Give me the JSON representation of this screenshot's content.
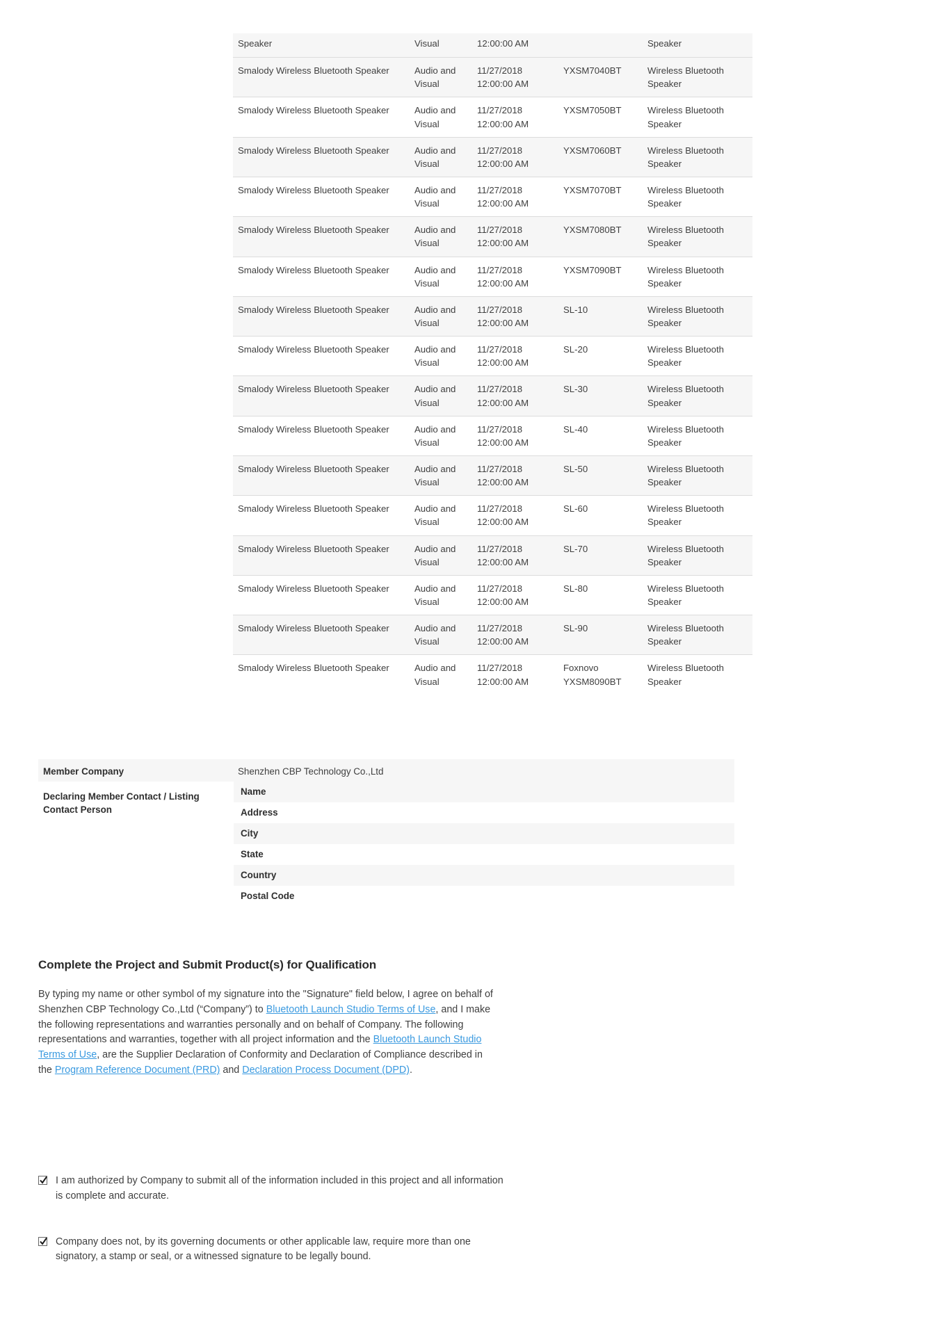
{
  "product_table": {
    "partial_first_row": {
      "name": "Speaker",
      "type": "Visual",
      "date": "12:00:00 AM",
      "model": "",
      "category": "Speaker"
    },
    "rows": [
      {
        "name": "Smalody Wireless Bluetooth Speaker",
        "type": "Audio and Visual",
        "date": "11/27/2018 12:00:00 AM",
        "model": "YXSM7040BT",
        "category": "Wireless Bluetooth Speaker"
      },
      {
        "name": "Smalody Wireless Bluetooth Speaker",
        "type": "Audio and Visual",
        "date": "11/27/2018 12:00:00 AM",
        "model": "YXSM7050BT",
        "category": "Wireless Bluetooth Speaker"
      },
      {
        "name": "Smalody Wireless Bluetooth Speaker",
        "type": "Audio and Visual",
        "date": "11/27/2018 12:00:00 AM",
        "model": "YXSM7060BT",
        "category": "Wireless Bluetooth Speaker"
      },
      {
        "name": "Smalody Wireless Bluetooth Speaker",
        "type": "Audio and Visual",
        "date": "11/27/2018 12:00:00 AM",
        "model": "YXSM7070BT",
        "category": "Wireless Bluetooth Speaker"
      },
      {
        "name": "Smalody Wireless Bluetooth Speaker",
        "type": "Audio and Visual",
        "date": "11/27/2018 12:00:00 AM",
        "model": "YXSM7080BT",
        "category": "Wireless Bluetooth Speaker"
      },
      {
        "name": "Smalody Wireless Bluetooth Speaker",
        "type": "Audio and Visual",
        "date": "11/27/2018 12:00:00 AM",
        "model": "YXSM7090BT",
        "category": "Wireless Bluetooth Speaker"
      },
      {
        "name": "Smalody Wireless Bluetooth Speaker",
        "type": "Audio and Visual",
        "date": "11/27/2018 12:00:00 AM",
        "model": "SL-10",
        "category": "Wireless Bluetooth Speaker"
      },
      {
        "name": "Smalody Wireless Bluetooth Speaker",
        "type": "Audio and Visual",
        "date": "11/27/2018 12:00:00 AM",
        "model": "SL-20",
        "category": "Wireless Bluetooth Speaker"
      },
      {
        "name": "Smalody Wireless Bluetooth Speaker",
        "type": "Audio and Visual",
        "date": "11/27/2018 12:00:00 AM",
        "model": "SL-30",
        "category": "Wireless Bluetooth Speaker"
      },
      {
        "name": "Smalody Wireless Bluetooth Speaker",
        "type": "Audio and Visual",
        "date": "11/27/2018 12:00:00 AM",
        "model": "SL-40",
        "category": "Wireless Bluetooth Speaker"
      },
      {
        "name": "Smalody Wireless Bluetooth Speaker",
        "type": "Audio and Visual",
        "date": "11/27/2018 12:00:00 AM",
        "model": "SL-50",
        "category": "Wireless Bluetooth Speaker"
      },
      {
        "name": "Smalody Wireless Bluetooth Speaker",
        "type": "Audio and Visual",
        "date": "11/27/2018 12:00:00 AM",
        "model": "SL-60",
        "category": "Wireless Bluetooth Speaker"
      },
      {
        "name": "Smalody Wireless Bluetooth Speaker",
        "type": "Audio and Visual",
        "date": "11/27/2018 12:00:00 AM",
        "model": "SL-70",
        "category": "Wireless Bluetooth Speaker"
      },
      {
        "name": "Smalody Wireless Bluetooth Speaker",
        "type": "Audio and Visual",
        "date": "11/27/2018 12:00:00 AM",
        "model": "SL-80",
        "category": "Wireless Bluetooth Speaker"
      },
      {
        "name": "Smalody Wireless Bluetooth Speaker",
        "type": "Audio and Visual",
        "date": "11/27/2018 12:00:00 AM",
        "model": "SL-90",
        "category": "Wireless Bluetooth Speaker"
      },
      {
        "name": "Smalody Wireless Bluetooth Speaker",
        "type": "Audio and Visual",
        "date": "11/27/2018 12:00:00 AM",
        "model": "Foxnovo YXSM8090BT",
        "category": "Wireless Bluetooth Speaker"
      }
    ]
  },
  "member_section": {
    "member_company_label": "Member Company",
    "member_company_value": "Shenzhen CBP Technology Co.,Ltd",
    "contact_label": "Declaring Member Contact / Listing Contact Person",
    "contact_fields": [
      "Name",
      "Address",
      "City",
      "State",
      "Country",
      "Postal Code"
    ]
  },
  "declaration": {
    "heading": "Complete the Project and Submit Product(s) for Qualification",
    "paragraph": {
      "p1": "By typing my name or other symbol of my signature into the \"Signature\" field below, I agree on behalf of Shenzhen CBP Technology Co.,Ltd (“Company”) to ",
      "link1": "Bluetooth Launch Studio Terms of Use",
      "p2": ", and I make the following representations and warranties personally and on behalf of Company. The following representations and warranties, together with all project information and the ",
      "link2": "Bluetooth Launch Studio Terms of Use",
      "p3": ", are the Supplier Declaration of Conformity and Declaration of Compliance described in the ",
      "link3": "Program Reference Document (PRD)",
      "p4": " and ",
      "link4": "Declaration Process Document (DPD)",
      "p5": "."
    },
    "checklist": [
      {
        "checked": true,
        "text": "I am authorized by Company to submit all of the information included in this project and all information is complete and accurate."
      },
      {
        "checked": true,
        "text": "Company does not, by its governing documents or other applicable law, require more than one signatory, a stamp or seal, or a witnessed signature to be legally bound."
      }
    ]
  },
  "colors": {
    "link": "#3a9ae0",
    "row_shade": "#f6f6f6",
    "text": "#3f3f3f"
  }
}
